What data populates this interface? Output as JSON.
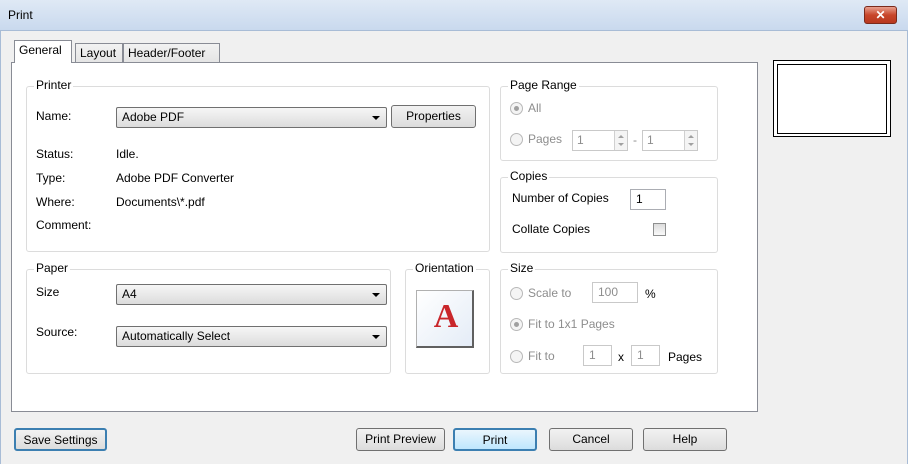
{
  "window": {
    "title": "Print",
    "close_glyph": "✕"
  },
  "tabs": [
    "General",
    "Layout",
    "Header/Footer"
  ],
  "printer": {
    "group_label": "Printer",
    "name_label": "Name:",
    "name_value": "Adobe PDF",
    "properties_button": "Properties",
    "status_label": "Status:",
    "status_value": "Idle.",
    "type_label": "Type:",
    "type_value": "Adobe PDF Converter",
    "where_label": "Where:",
    "where_value": "Documents\\*.pdf",
    "comment_label": "Comment:",
    "comment_value": ""
  },
  "paper": {
    "group_label": "Paper",
    "size_label": "Size",
    "size_value": "A4",
    "source_label": "Source:",
    "source_value": "Automatically Select"
  },
  "orientation": {
    "group_label": "Orientation",
    "icon_letter": "A"
  },
  "page_range": {
    "group_label": "Page Range",
    "all_label": "All",
    "pages_label": "Pages",
    "from_value": "1",
    "dash": "-",
    "to_value": "1"
  },
  "copies": {
    "group_label": "Copies",
    "number_label": "Number of Copies",
    "number_value": "1",
    "collate_label": "Collate Copies",
    "collate_checked": false
  },
  "size": {
    "group_label": "Size",
    "scale_label": "Scale to",
    "scale_value": "100",
    "percent": "%",
    "fit_1x1_label": "Fit to 1x1 Pages",
    "fit_label": "Fit to",
    "fit_x_value": "1",
    "x_sep": "x",
    "fit_y_value": "1",
    "pages_suffix": "Pages"
  },
  "buttons": {
    "save_settings": "Save Settings",
    "print_preview": "Print Preview",
    "print": "Print",
    "cancel": "Cancel",
    "help": "Help"
  },
  "colors": {
    "close_button": "#c8462b",
    "default_button_border": "#3c7fb1"
  }
}
